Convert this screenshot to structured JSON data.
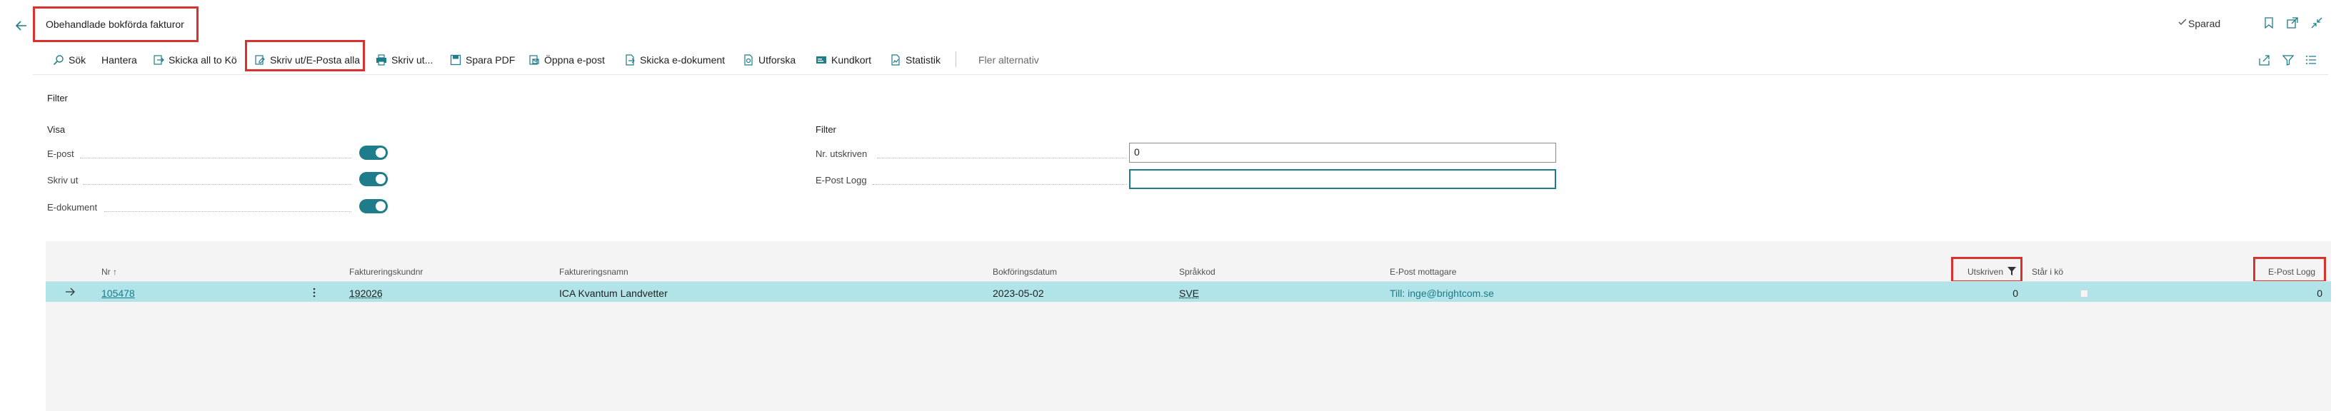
{
  "header": {
    "title": "Obehandlade bokförda fakturor",
    "saved_label": "Sparad"
  },
  "actions": {
    "sok": "Sök",
    "hantera": "Hantera",
    "skicka_all": "Skicka all to Kö",
    "skriv_ut_alla": "Skriv ut/E-Posta alla",
    "skriv_ut": "Skriv ut...",
    "spara_pdf": "Spara PDF",
    "oppna_epost": "Öppna e-post",
    "skicka_edok": "Skicka e-dokument",
    "utforska": "Utforska",
    "kundkort": "Kundkort",
    "statistik": "Statistik",
    "fler": "Fler alternativ"
  },
  "filter": {
    "heading": "Filter",
    "visa": {
      "heading": "Visa",
      "epost": "E-post",
      "skriv_ut": "Skriv ut",
      "edokument": "E-dokument"
    },
    "right": {
      "heading": "Filter",
      "nr_utskriven_label": "Nr. utskriven",
      "nr_utskriven_value": "0",
      "epost_logg_label": "E-Post Logg",
      "epost_logg_value": ""
    }
  },
  "grid": {
    "columns": {
      "nr": "Nr ↑",
      "kundnr": "Faktureringskundnr",
      "namn": "Faktureringsnamn",
      "datum": "Bokföringsdatum",
      "sprakkod": "Språkkod",
      "mottagare": "E-Post mottagare",
      "utskriven": "Utskriven",
      "star_i_ko": "Står i kö",
      "epost_logg": "E-Post Logg"
    },
    "rows": [
      {
        "nr": "105478",
        "kundnr": "192026",
        "namn": "ICA Kvantum Landvetter",
        "datum": "2023-05-02",
        "sprakkod": "SVE",
        "mottagare": "Till: inge@brightcom.se",
        "utskriven": "0",
        "epost_logg": "0"
      }
    ]
  },
  "colors": {
    "accent": "#1f7c8a",
    "highlight": "#d9312b",
    "row_selected": "#b1e4e8"
  }
}
